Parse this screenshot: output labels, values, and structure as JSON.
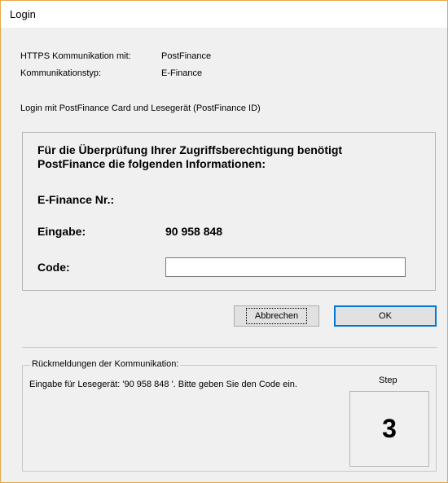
{
  "window": {
    "title": "Login"
  },
  "info": {
    "https_label": "HTTPS Kommunikation mit:",
    "https_value": "PostFinance",
    "type_label": "Kommunikationstyp:",
    "type_value": "E-Finance",
    "login_method": "Login mit PostFinance Card und Lesegerät (PostFinance ID)"
  },
  "auth": {
    "heading_line1": "Für die Überprüfung Ihrer Zugriffsberechtigung benötigt",
    "heading_line2": "PostFinance die folgenden Informationen:",
    "efinance_label": "E-Finance Nr.:",
    "eingabe_label": "Eingabe:",
    "eingabe_value": "90 958 848",
    "code_label": "Code:",
    "code_value": ""
  },
  "buttons": {
    "cancel": "Abbrechen",
    "ok": "OK"
  },
  "feedback": {
    "legend": "Rückmeldungen der Kommunikation:",
    "message": "Eingabe für Lesegerät: '90 958 848 '. Bitte geben Sie den Code ein.",
    "step_label": "Step",
    "step_value": "3"
  }
}
